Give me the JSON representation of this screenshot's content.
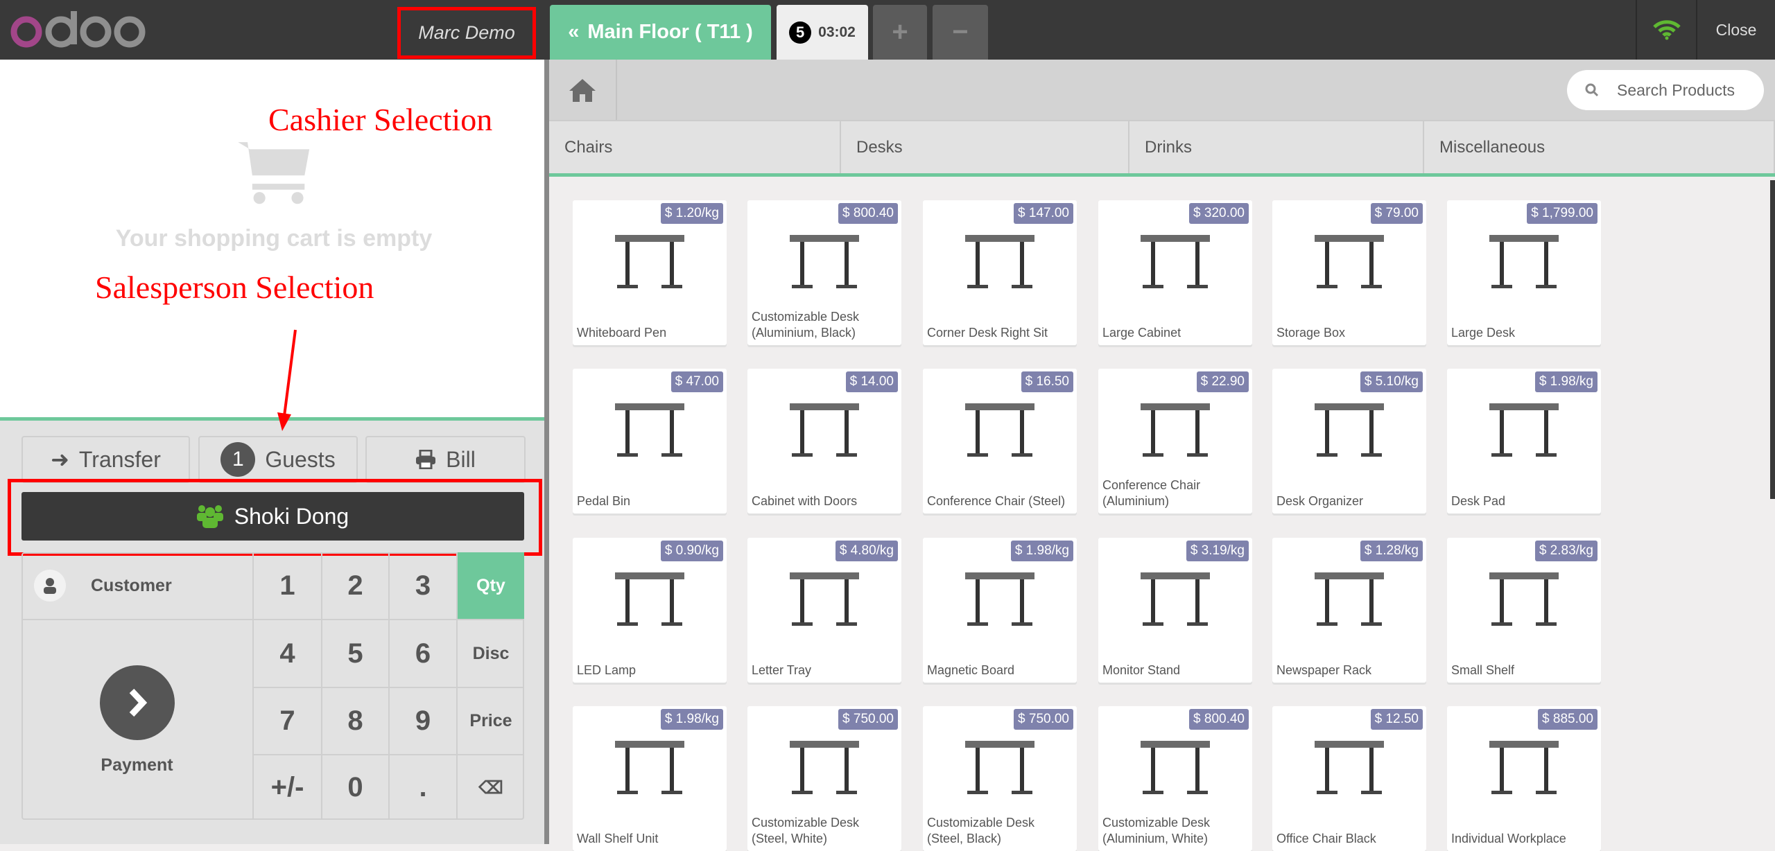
{
  "header": {
    "logo": "odoo",
    "cashier": "Marc Demo",
    "floor_tab": "Main Floor ( T11 )",
    "order_badge": "5",
    "order_time": "03:02",
    "add_order": "+",
    "remove_order": "−",
    "close": "Close",
    "wifi_color": "#5fb832"
  },
  "annotations": {
    "cashier": "Cashier Selection",
    "salesperson": "Salesperson Selection"
  },
  "cart": {
    "empty_text": "Your shopping cart is empty"
  },
  "actions": {
    "transfer": "Transfer",
    "guests_count": "1",
    "guests": "Guests",
    "bill": "Bill"
  },
  "salesperson": {
    "name": "Shoki Dong"
  },
  "pad": {
    "customer": "Customer",
    "payment": "Payment",
    "keys": [
      "1",
      "2",
      "3",
      "Qty",
      "4",
      "5",
      "6",
      "Disc",
      "7",
      "8",
      "9",
      "Price",
      "+/-",
      "0",
      ".",
      "⌫"
    ],
    "active_mode": "Qty"
  },
  "search": {
    "placeholder": "Search Products"
  },
  "categories": [
    "Chairs",
    "Desks",
    "Drinks",
    "Miscellaneous"
  ],
  "colors": {
    "accent": "#6ec89b",
    "header": "#393939",
    "price_tag": "#7f82ac"
  },
  "products": [
    {
      "name": "Whiteboard Pen",
      "price": "$ 1.20/kg"
    },
    {
      "name": "Customizable Desk (Aluminium, Black)",
      "price": "$ 800.40"
    },
    {
      "name": "Corner Desk Right Sit",
      "price": "$ 147.00"
    },
    {
      "name": "Large Cabinet",
      "price": "$ 320.00"
    },
    {
      "name": "Storage Box",
      "price": "$ 79.00"
    },
    {
      "name": "Large Desk",
      "price": "$ 1,799.00"
    },
    {
      "name": "Pedal Bin",
      "price": "$ 47.00"
    },
    {
      "name": "Cabinet with Doors",
      "price": "$ 14.00"
    },
    {
      "name": "Conference Chair (Steel)",
      "price": "$ 16.50"
    },
    {
      "name": "Conference Chair (Aluminium)",
      "price": "$ 22.90"
    },
    {
      "name": "Desk Organizer",
      "price": "$ 5.10/kg"
    },
    {
      "name": "Desk Pad",
      "price": "$ 1.98/kg"
    },
    {
      "name": "LED Lamp",
      "price": "$ 0.90/kg"
    },
    {
      "name": "Letter Tray",
      "price": "$ 4.80/kg"
    },
    {
      "name": "Magnetic Board",
      "price": "$ 1.98/kg"
    },
    {
      "name": "Monitor Stand",
      "price": "$ 3.19/kg"
    },
    {
      "name": "Newspaper Rack",
      "price": "$ 1.28/kg"
    },
    {
      "name": "Small Shelf",
      "price": "$ 2.83/kg"
    },
    {
      "name": "Wall Shelf Unit",
      "price": "$ 1.98/kg"
    },
    {
      "name": "Customizable Desk (Steel, White)",
      "price": "$ 750.00"
    },
    {
      "name": "Customizable Desk (Steel, Black)",
      "price": "$ 750.00"
    },
    {
      "name": "Customizable Desk (Aluminium, White)",
      "price": "$ 800.40"
    },
    {
      "name": "Office Chair Black",
      "price": "$ 12.50"
    },
    {
      "name": "Individual Workplace",
      "price": "$ 885.00"
    }
  ]
}
